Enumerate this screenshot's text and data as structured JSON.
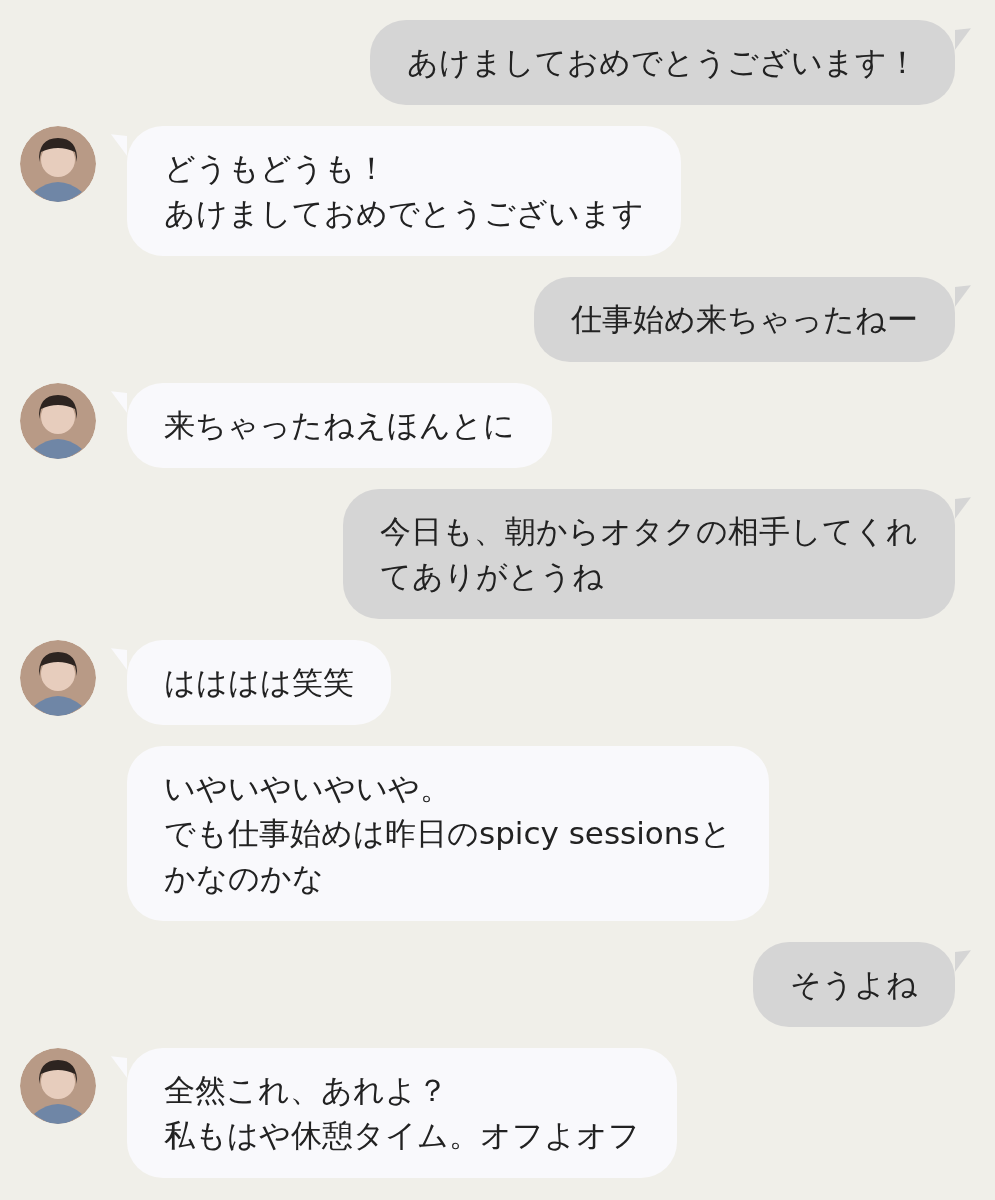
{
  "messages": [
    {
      "kind": "sent",
      "lines": [
        "あけましておめでとうございます！"
      ]
    },
    {
      "kind": "received",
      "avatar": true,
      "lines": [
        "どうもどうも！",
        "あけましておめでとうございます"
      ]
    },
    {
      "kind": "sent",
      "lines": [
        "仕事始め来ちゃったねー"
      ]
    },
    {
      "kind": "received",
      "avatar": true,
      "lines": [
        "来ちゃったねえほんとに"
      ]
    },
    {
      "kind": "sent",
      "lines": [
        "今日も、朝からオタクの相手してくれ",
        "てありがとうね"
      ]
    },
    {
      "kind": "received",
      "avatar": true,
      "lines": [
        "はははは笑笑"
      ]
    },
    {
      "kind": "received",
      "avatar": false,
      "lines": [
        "いやいやいやいや。",
        "でも仕事始めは昨日のspicy sessionsと",
        "かなのかな"
      ]
    },
    {
      "kind": "sent",
      "lines": [
        "そうよね"
      ]
    },
    {
      "kind": "received",
      "avatar": true,
      "lines": [
        "全然これ、あれよ？",
        "私もはや休憩タイム。オフよオフ"
      ]
    }
  ]
}
